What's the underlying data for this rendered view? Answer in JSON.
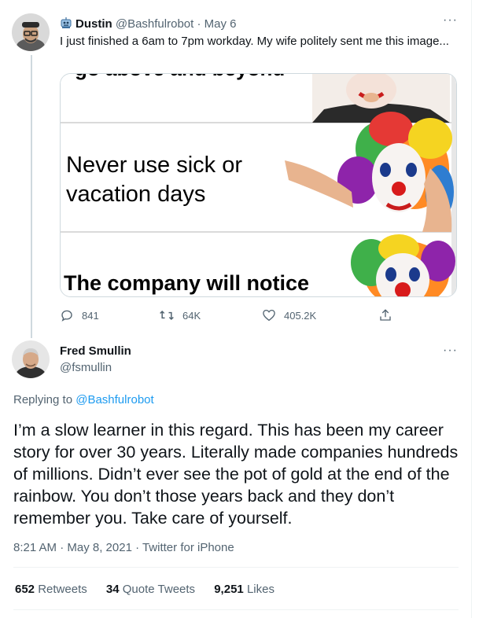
{
  "tweet1": {
    "author_name": "Dustin",
    "handle": "@Bashfulrobot",
    "date": "May 6",
    "text": "I just finished a 6am to 7pm workday. My wife politely sent me this image...",
    "media_text": {
      "top": "go above and beyond",
      "middle": "Never use sick or vacation days",
      "bottom": "The company will notice"
    },
    "actions": {
      "replies": "841",
      "retweets": "64K",
      "likes": "405.2K"
    }
  },
  "tweet2": {
    "author_name": "Fred Smullin",
    "handle": "@fsmullin",
    "replying_prefix": "Replying to ",
    "replying_to": "@Bashfulrobot",
    "text": "I’m a slow learner in this regard. This has been my career story for over 30 years. Literally made companies hundreds of millions. Didn’t ever see the pot of gold at the end of the rainbow. You don’t those years back and they don’t remember you. Take care of yourself.",
    "timestamp": "8:21 AM · May 8, 2021 · Twitter for iPhone",
    "stats": {
      "retweets_count": "652",
      "retweets_label": "Retweets",
      "quotes_count": "34",
      "quotes_label": "Quote Tweets",
      "likes_count": "9,251",
      "likes_label": "Likes"
    }
  },
  "more_glyph": "···",
  "colors": {
    "accent": "#1d9bf0",
    "muted": "#536471",
    "text": "#0f1419"
  }
}
